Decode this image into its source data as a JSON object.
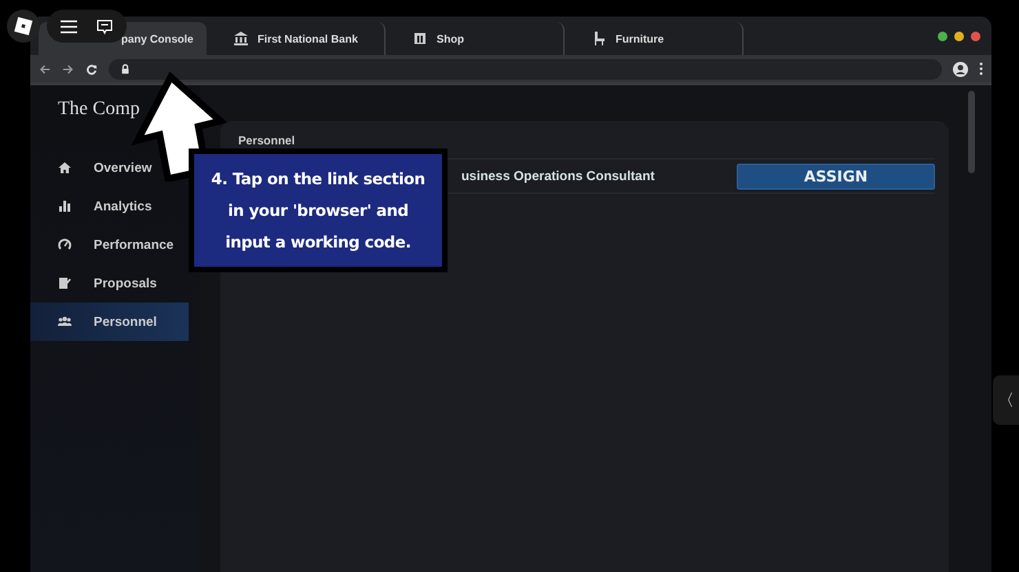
{
  "tabs": [
    {
      "label": "pany Console",
      "selected": true
    },
    {
      "label": "First National Bank",
      "selected": false
    },
    {
      "label": "Shop",
      "selected": false
    },
    {
      "label": "Furniture",
      "selected": false
    }
  ],
  "sidebar": {
    "title": "The Comp",
    "items": [
      {
        "label": "Overview",
        "selected": false
      },
      {
        "label": "Analytics",
        "selected": false
      },
      {
        "label": "Performance",
        "selected": false
      },
      {
        "label": "Proposals",
        "selected": false
      },
      {
        "label": "Personnel",
        "selected": true
      }
    ]
  },
  "panel": {
    "heading": "Personnel",
    "rows": [
      {
        "role": "usiness Operations Consultant",
        "button": "ASSIGN"
      }
    ]
  },
  "callout": {
    "text": "4. Tap on the link section in your 'browser' and input a working code."
  },
  "side_tab": {
    "label": "〈"
  }
}
